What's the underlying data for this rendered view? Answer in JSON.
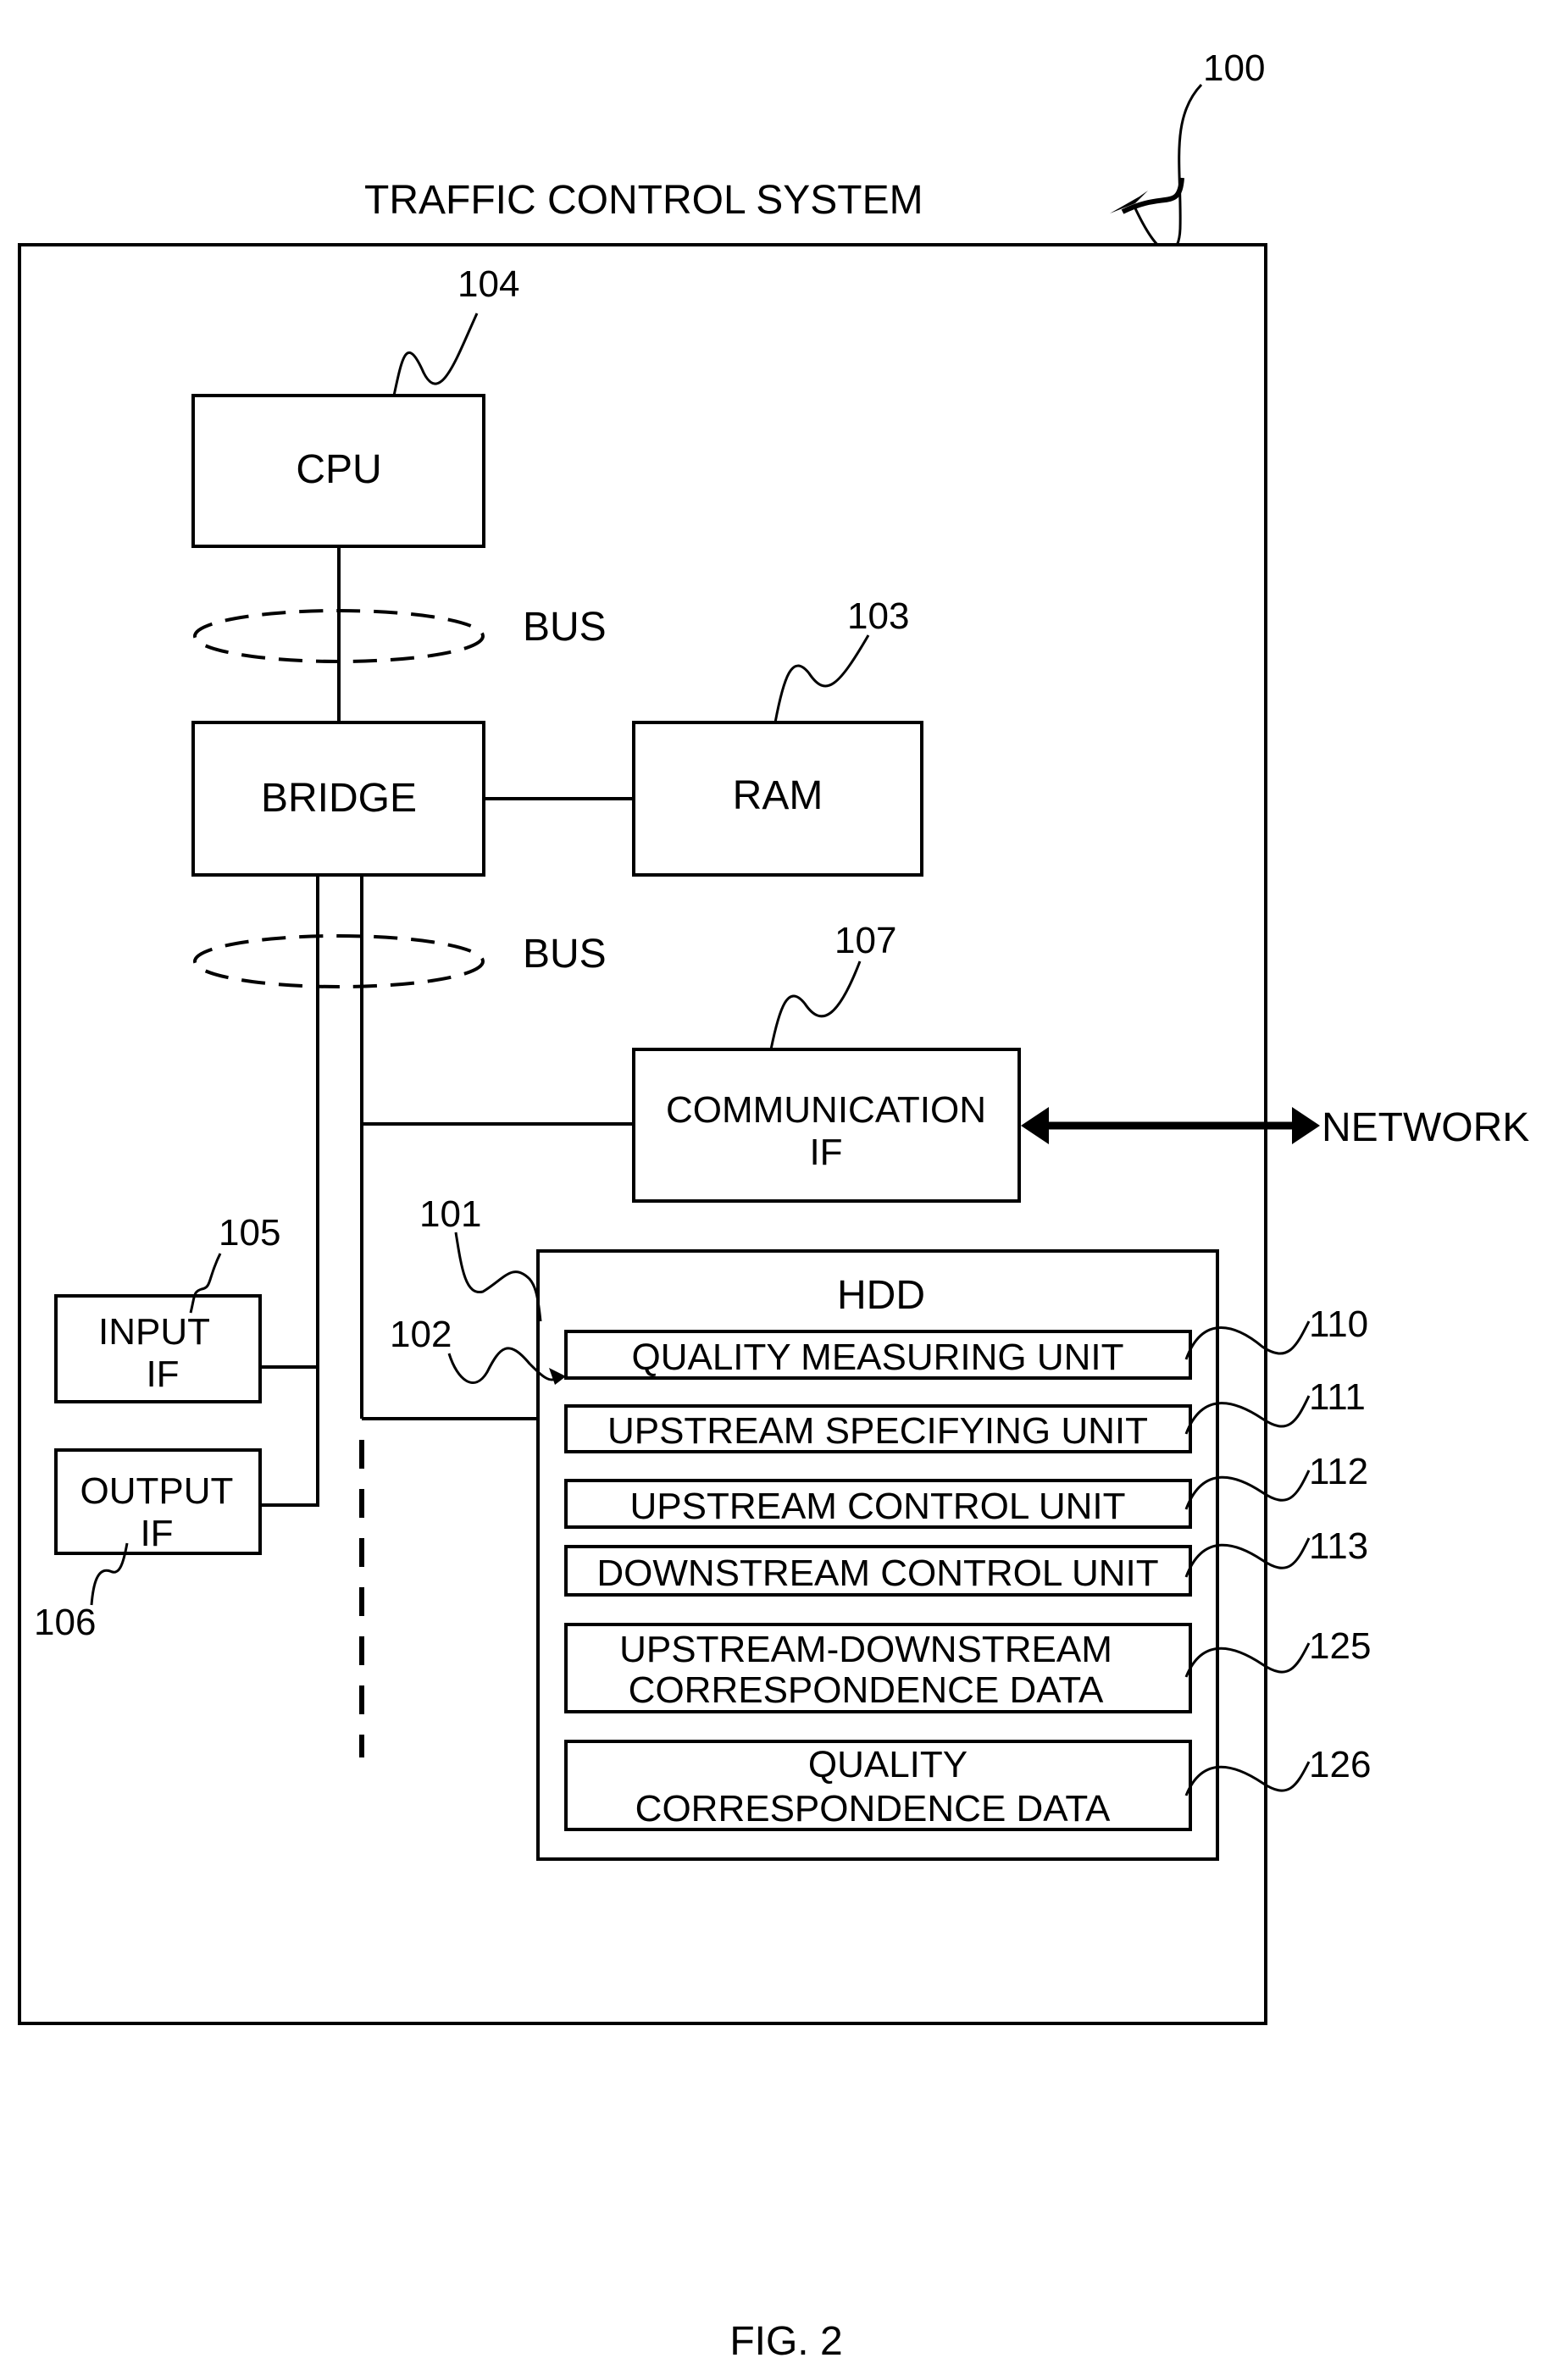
{
  "figure": {
    "ref_system": "100",
    "title": "TRAFFIC CONTROL SYSTEM",
    "caption": "FIG. 2"
  },
  "blocks": {
    "cpu": {
      "label": "CPU",
      "ref": "104"
    },
    "bridge": {
      "label": "BRIDGE"
    },
    "ram": {
      "label": "RAM",
      "ref": "103"
    },
    "comm": {
      "label_line1": "COMMUNICATION",
      "label_line2": "IF",
      "ref": "107"
    },
    "input_if": {
      "label_line1": "INPUT",
      "label_line2": "IF",
      "ref": "105"
    },
    "output_if": {
      "label_line1": "OUTPUT",
      "label_line2": "IF",
      "ref": "106"
    },
    "hdd": {
      "label": "HDD",
      "ref": "101",
      "ref_program": "102"
    }
  },
  "bus_labels": [
    "BUS",
    "BUS"
  ],
  "network_label": "NETWORK",
  "hdd_units": [
    {
      "label": "QUALITY MEASURING UNIT",
      "ref": "110"
    },
    {
      "label": "UPSTREAM SPECIFYING UNIT",
      "ref": "111"
    },
    {
      "label": "UPSTREAM CONTROL UNIT",
      "ref": "112"
    },
    {
      "label": "DOWNSTREAM CONTROL UNIT",
      "ref": "113"
    },
    {
      "label_line1": "UPSTREAM-DOWNSTREAM",
      "label_line2": "CORRESPONDENCE DATA",
      "ref": "125"
    },
    {
      "label_line1": "QUALITY",
      "label_line2": "CORRESPONDENCE DATA",
      "ref": "126"
    }
  ]
}
